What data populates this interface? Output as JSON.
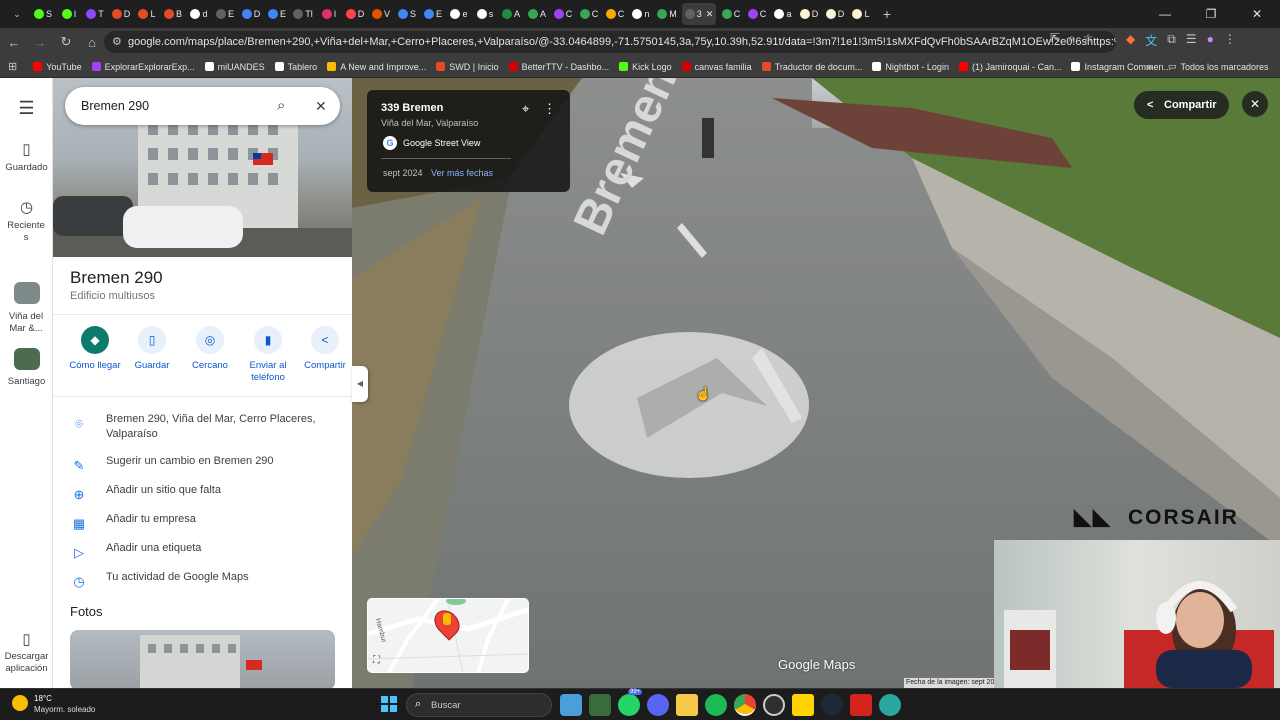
{
  "browser": {
    "tabs": [
      {
        "label": "S",
        "color": "#53fc18"
      },
      {
        "label": "I",
        "color": "#53fc18"
      },
      {
        "label": "T",
        "color": "#9146ff"
      },
      {
        "label": "D",
        "color": "#e34c26"
      },
      {
        "label": "L",
        "color": "#e34c26"
      },
      {
        "label": "B",
        "color": "#e34c26"
      },
      {
        "label": "d",
        "color": "#ffffff"
      },
      {
        "label": "E",
        "color": "#5f6368"
      },
      {
        "label": "D",
        "color": "#4285f4"
      },
      {
        "label": "E",
        "color": "#4285f4"
      },
      {
        "label": "Tl",
        "color": "#5f6368"
      },
      {
        "label": "I",
        "color": "#e1306c"
      },
      {
        "label": "D",
        "color": "#ff424d"
      },
      {
        "label": "V",
        "color": "#e65100"
      },
      {
        "label": "S",
        "color": "#4285f4"
      },
      {
        "label": "E",
        "color": "#4285f4"
      },
      {
        "label": "e",
        "color": "#ffffff"
      },
      {
        "label": "s",
        "color": "#ffffff"
      },
      {
        "label": "A",
        "color": "#1e8e3e"
      },
      {
        "label": "A",
        "color": "#34a853"
      },
      {
        "label": "C",
        "color": "#a142f4"
      },
      {
        "label": "C",
        "color": "#34a853"
      },
      {
        "label": "C",
        "color": "#f9ab00"
      },
      {
        "label": "n",
        "color": "#ffffff"
      },
      {
        "label": "M",
        "color": "#34a853"
      },
      {
        "label": "3",
        "color": "#5f6368",
        "active": true
      },
      {
        "label": "C",
        "color": "#34a853"
      },
      {
        "label": "C",
        "color": "#a142f4"
      },
      {
        "label": "a",
        "color": "#ffffff"
      },
      {
        "label": "D",
        "color": "#fbf3d5"
      },
      {
        "label": "D",
        "color": "#fbf3d5"
      },
      {
        "label": "L",
        "color": "#fbf3d5"
      }
    ],
    "url": "google.com/maps/place/Bremen+290,+Viña+del+Mar,+Cerro+Placeres,+Valparaíso/@-33.0464899,-71.5750145,3a,75y,10.39h,52.91t/data=!3m7!1e1!3m5!1sMXFdQvFh0bSAArBZqM1OEw!2e0!6shttps:%2F%2Fstreetviewpi...",
    "bookmarks": [
      {
        "label": "YouTube",
        "color": "#ff0000"
      },
      {
        "label": "ExplorarExplorarExp...",
        "color": "#a142f4"
      },
      {
        "label": "miUANDES",
        "color": "#ffffff"
      },
      {
        "label": "Tablero",
        "color": "#ffffff"
      },
      {
        "label": "A New and Improve...",
        "color": "#fbbc04"
      },
      {
        "label": "SWD | Inicio",
        "color": "#e34c26"
      },
      {
        "label": "BetterTTV - Dashbo...",
        "color": "#d50000"
      },
      {
        "label": "Kick Logo",
        "color": "#53fc18"
      },
      {
        "label": "canvas familia",
        "color": "#d50000"
      },
      {
        "label": "Traductor de docum...",
        "color": "#e34c26"
      },
      {
        "label": "Nightbot - Login",
        "color": "#ffffff"
      },
      {
        "label": "(1) Jamiroquai - Can...",
        "color": "#ff0000"
      },
      {
        "label": "Instagram Commen...",
        "color": "#ffffff"
      }
    ],
    "all_bookmarks": "Todos los marcadores"
  },
  "rail": {
    "saved": "Guardado",
    "recent": "Recientes",
    "recent1": "Viña del Mar &...",
    "recent2": "Santiago",
    "download": "Descargar aplicación"
  },
  "panel": {
    "search_value": "Bremen 290",
    "title": "Bremen 290",
    "subtitle": "Edificio multiusos",
    "actions": [
      {
        "label": "Cómo llegar",
        "icon": "directions-icon",
        "glyph": "◆"
      },
      {
        "label": "Guardar",
        "icon": "bookmark-icon",
        "glyph": "▯"
      },
      {
        "label": "Cercano",
        "icon": "nearby-icon",
        "glyph": "◎"
      },
      {
        "label": "Enviar al teléfono",
        "icon": "phone-icon",
        "glyph": "▮"
      },
      {
        "label": "Compartir",
        "icon": "share-icon",
        "glyph": "<"
      }
    ],
    "address": "Bremen 290, Viña del Mar, Cerro Placeres, Valparaíso",
    "suggest": "Sugerir un cambio en Bremen 290",
    "add_place": "Añadir un sitio que falta",
    "add_business": "Añadir tu empresa",
    "add_label": "Añadir una etiqueta",
    "activity": "Tu actividad de Google Maps",
    "photos_heading": "Fotos"
  },
  "streetview": {
    "card_title": "339 Bremen",
    "card_subtitle": "Viña del Mar, Valparaíso",
    "card_source": "Google Street View",
    "card_date": "sept 2024",
    "card_more": "Ver más fechas",
    "share": "Compartir",
    "road_text": "Bremen",
    "watermark": "Google Maps",
    "image_date": "Fecha de la imagen: sept 20",
    "overlay_brand": "CORSAIR",
    "minimap_street": "Hambur"
  },
  "taskbar": {
    "temp": "18°C",
    "weather": "Mayorm. soleado",
    "search": "Buscar",
    "notif_badge": "99+"
  }
}
